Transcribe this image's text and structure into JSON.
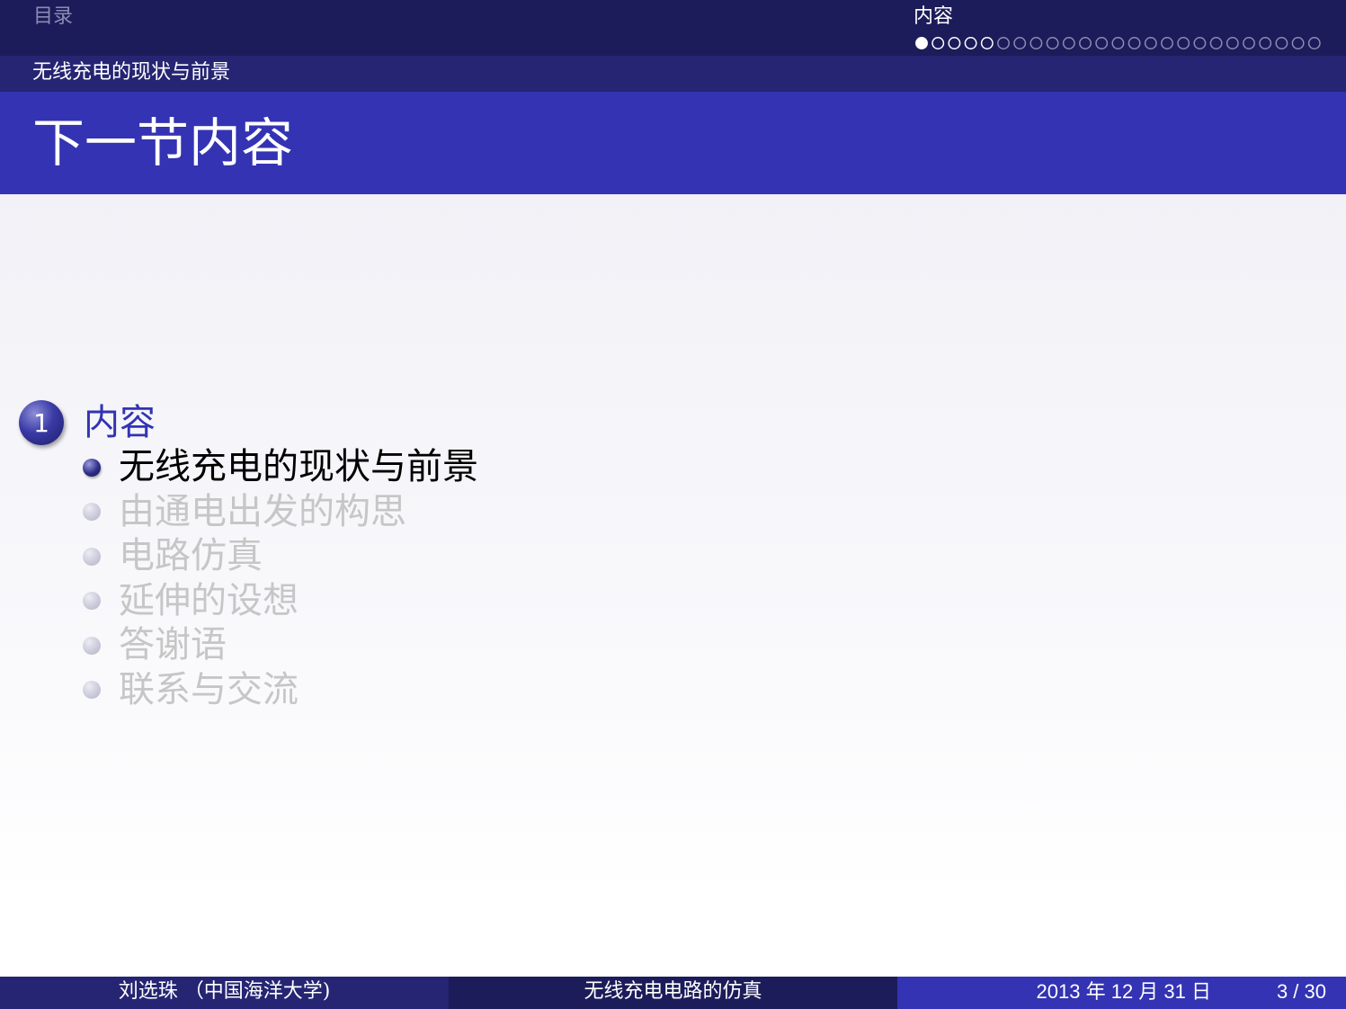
{
  "header": {
    "toc_label": "目录",
    "section_title": "内容",
    "progress_dots_total": 25,
    "progress_dots_current": 1,
    "subsection_title": "无线充电的现状与前景"
  },
  "frame": {
    "title": "下一节内容"
  },
  "toc": {
    "section_number": "1",
    "section_label": "内容",
    "items": [
      {
        "label": "无线充电的现状与前景",
        "active": true
      },
      {
        "label": "由通电出发的构思",
        "active": false
      },
      {
        "label": "电路仿真",
        "active": false
      },
      {
        "label": "延伸的设想",
        "active": false
      },
      {
        "label": "答谢语",
        "active": false
      },
      {
        "label": "联系与交流",
        "active": false
      }
    ]
  },
  "footer": {
    "author": "刘选珠 （中国海洋大学)",
    "title": "无线充电电路的仿真",
    "date": "2013 年 12 月 31 日",
    "page": "3 / 30"
  },
  "colors": {
    "nav_dark": "#1c1c5a",
    "nav_mid": "#252573",
    "accent": "#3333b3",
    "inactive_text": "#c6c6c6"
  }
}
